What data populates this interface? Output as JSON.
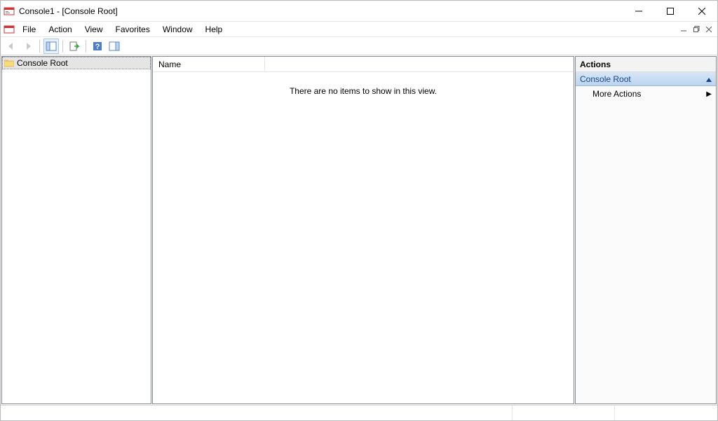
{
  "window": {
    "title": "Console1 - [Console Root]"
  },
  "menu": {
    "file": "File",
    "action": "Action",
    "view": "View",
    "favorites": "Favorites",
    "window": "Window",
    "help": "Help"
  },
  "tree": {
    "root_label": "Console Root"
  },
  "list": {
    "col_name": "Name",
    "empty_message": "There are no items to show in this view."
  },
  "actions": {
    "title": "Actions",
    "section": "Console Root",
    "more": "More Actions"
  }
}
